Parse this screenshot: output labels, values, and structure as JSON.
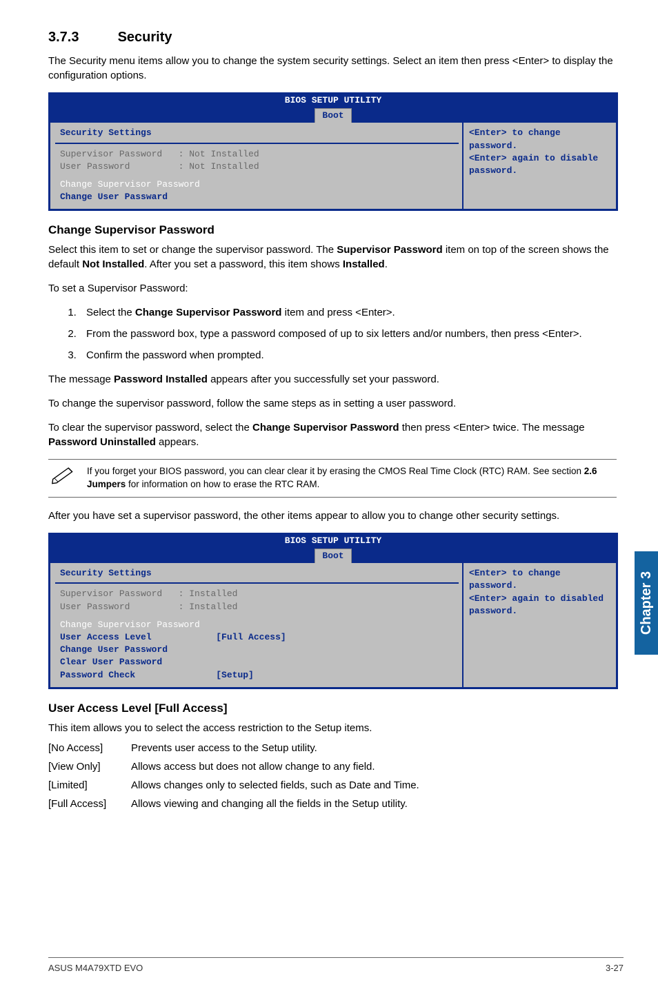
{
  "section": {
    "number": "3.7.3",
    "title": "Security"
  },
  "intro": "The Security menu items allow you to change the system security settings. Select an item then press <Enter> to display the configuration options.",
  "bios1": {
    "title": "BIOS SETUP UTILITY",
    "tab": "Boot",
    "heading": "Security Settings",
    "sp_label": "Supervisor Password",
    "up_label": "User Password",
    "sp_val": ": Not Installed",
    "up_val": ": Not Installed",
    "line1": "Change Supervisor Password",
    "line2": "Change User Passward",
    "help": "<Enter> to change password.\n<Enter> again to disable password."
  },
  "csp_heading": "Change Supervisor Password",
  "csp_p1_a": "Select this item to set or change the supervisor password. The ",
  "csp_p1_b": "Supervisor Password",
  "csp_p1_c": " item on top of the screen shows the default ",
  "csp_p1_d": "Not Installed",
  "csp_p1_e": ". After you set a password, this item shows ",
  "csp_p1_f": "Installed",
  "csp_p1_g": ".",
  "csp_set": "To set a Supervisor Password:",
  "steps": {
    "s1a": "Select the ",
    "s1b": "Change Supervisor Password",
    "s1c": " item and press <Enter>.",
    "s2": "From the password box, type a password composed of up to six letters and/or numbers, then press <Enter>.",
    "s3": "Confirm the password when prompted."
  },
  "msg1a": "The message ",
  "msg1b": "Password Installed",
  "msg1c": " appears after you successfully set your password.",
  "msg2": "To change the supervisor password, follow the same steps as in setting a user password.",
  "msg3a": "To clear the supervisor password, select the ",
  "msg3b": "Change Supervisor Password",
  "msg3c": " then press <Enter> twice. The message ",
  "msg3d": "Password Uninstalled",
  "msg3e": " appears.",
  "note_a": "If you forget your BIOS password, you can clear clear it by erasing the CMOS Real Time Clock (RTC) RAM. See section ",
  "note_b": "2.6 Jumpers",
  "note_c": " for information on how to erase the RTC RAM.",
  "after": "After you have set a supervisor password, the other items appear to allow you to change other security settings.",
  "bios2": {
    "title": "BIOS SETUP UTILITY",
    "tab": "Boot",
    "heading": "Security Settings",
    "sp_label": "Supervisor Password",
    "up_label": "User Password",
    "sp_val": ": Installed",
    "up_val": ": Installed",
    "l1": "Change Supervisor Password",
    "l2": "User Access Level",
    "l2v": "[Full Access]",
    "l3": "Change User Password",
    "l4": "Clear User Password",
    "l5": "Password Check",
    "l5v": "[Setup]",
    "help": "<Enter> to change password.\n<Enter> again to disabled password."
  },
  "ual_heading": "User Access Level [Full Access]",
  "ual_intro": "This item allows you to select the access restriction to the Setup items.",
  "defs": {
    "k1": "[No Access]",
    "v1": "Prevents user access to the Setup utility.",
    "k2": "[View Only]",
    "v2": "Allows access but does not allow change to any field.",
    "k3": "[Limited]",
    "v3": "Allows changes only to selected fields, such as Date and Time.",
    "k4": "[Full Access]",
    "v4": "Allows viewing and changing all the fields in the Setup utility."
  },
  "side_tab": "Chapter 3",
  "footer_left": "ASUS M4A79XTD EVO",
  "footer_right": "3-27"
}
